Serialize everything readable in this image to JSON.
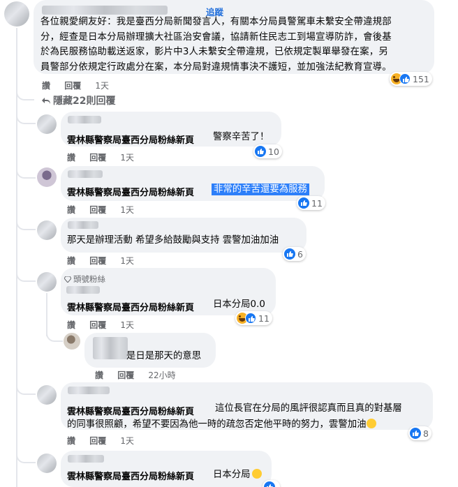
{
  "main_comment": {
    "follow_label": "追蹤",
    "lines": [
      "各位親愛網友好：我是臺西分局新聞發言人，有關本分局員警駕車未繫安全帶違規部",
      "分，經查是日本分局辦理擴大社區治安會議，協請新住民志工到場宣導防詐，會後基",
      "於為民服務協助載送返家，影片中3人未繫安全帶違規，已依規定製單舉發在案，另",
      "員警部分依規定行政處分在案，本分局對違規情事決不護短，並加強法紀教育宣導。"
    ],
    "reaction_count": "151",
    "actions": {
      "like": "讚",
      "reply": "回覆",
      "time": "1天"
    }
  },
  "hidden_replies_label": "隱藏22則回覆",
  "replies": [
    {
      "author": "雲林縣警察局臺西分局粉絲新頁",
      "text": "警察辛苦了！",
      "count": "10",
      "time": "1天"
    },
    {
      "author": "雲林縣警察局臺西分局粉絲新頁",
      "text": "非常的辛苦還要為服務",
      "count": "11",
      "time": "1天"
    },
    {
      "author": "",
      "text": "那天是辦理活動 希望多給鼓勵與支持 雲警加油加油",
      "count": "6",
      "time": "1天"
    },
    {
      "badge": "頭號粉絲",
      "author": "雲林縣警察局臺西分局粉絲新頁",
      "text": "日本分局0.0",
      "count": "11",
      "time": "1天"
    },
    {
      "author": "",
      "text": "是日是那天的意思",
      "time": "22小時"
    },
    {
      "author": "雲林縣警察局臺西分局粉絲新頁",
      "text": "這位長官在分局的風評很認真而且真的對基層",
      "text2": "的同事很照顧，希望不要因為他一時的疏忽否定他平時的努力，雲警加油",
      "count": "8",
      "time": "1天"
    },
    {
      "author": "雲林縣警察局臺西分局粉絲新頁",
      "text": "日本分局"
    }
  ],
  "action_labels": {
    "like": "讚",
    "reply": "回覆"
  },
  "colors": {
    "bubble": "#f0f2f5",
    "like_blue": "#1877f2",
    "link_blue": "#216fdb",
    "highlight": "#2d7ff9",
    "meta_gray": "#65676b"
  }
}
